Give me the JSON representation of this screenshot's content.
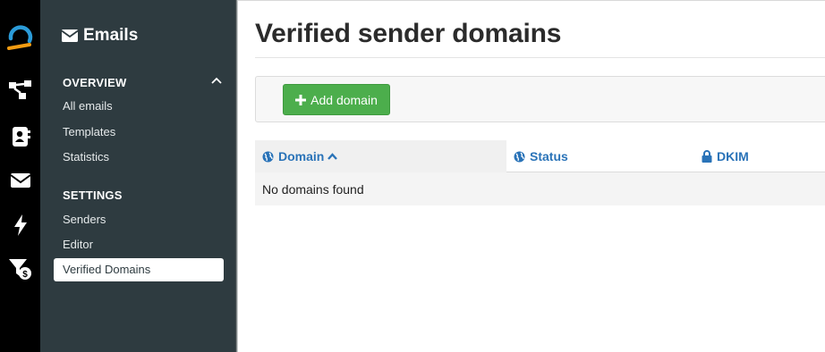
{
  "sidebar": {
    "title": "Emails",
    "sections": [
      {
        "label": "OVERVIEW",
        "items": [
          "All emails",
          "Templates",
          "Statistics"
        ]
      },
      {
        "label": "SETTINGS",
        "items": [
          "Senders",
          "Editor",
          "Verified Domains"
        ]
      }
    ]
  },
  "main": {
    "title": "Verified sender domains",
    "add_button_label": "Add domain",
    "table": {
      "columns": [
        "Domain",
        "Status",
        "DKIM"
      ],
      "empty_text": "No domains found"
    }
  },
  "colors": {
    "accent_blue": "#2a73b8",
    "button_green": "#4cae4c",
    "sidebar_bg": "#2e3b40",
    "logo_blue": "#2b9bd8",
    "logo_orange": "#f39c12"
  },
  "icons": {
    "rail": [
      "logo-icon",
      "workflow-icon",
      "contacts-icon",
      "email-icon",
      "bolt-icon",
      "funnel-dollar-icon"
    ]
  }
}
